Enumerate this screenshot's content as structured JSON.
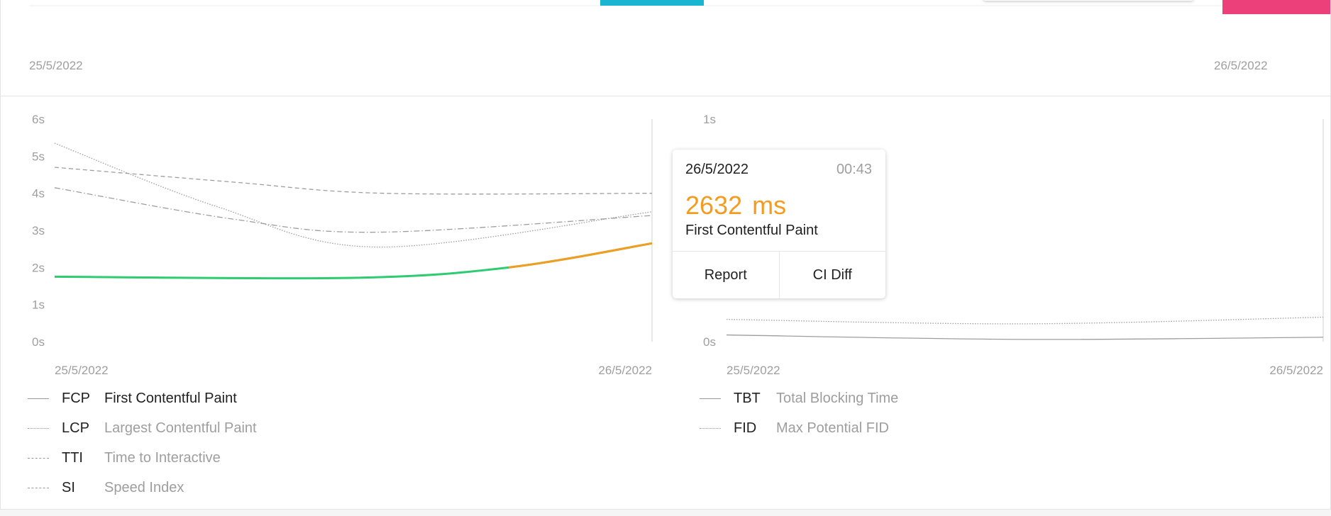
{
  "top_panel": {
    "x_start": "25/5/2022",
    "x_end": "26/5/2022",
    "colors": {
      "teal": "#1ab5d0",
      "pink": "#ec407a"
    }
  },
  "chart_data": [
    {
      "type": "line",
      "x": [
        "25/5/2022",
        "26/5/2022"
      ],
      "ylim": [
        0,
        6
      ],
      "y_unit": "s",
      "y_ticks": [
        "0s",
        "1s",
        "2s",
        "3s",
        "4s",
        "5s",
        "6s"
      ],
      "series": [
        {
          "name": "First Contentful Paint",
          "abbr": "FCP",
          "style": "solid",
          "color": "#2ecc71",
          "highlight_color": "#f39c1f",
          "points": [
            [
              0,
              1.75
            ],
            [
              0.5,
              1.72
            ],
            [
              0.76,
              2.0
            ],
            [
              1.0,
              2.65
            ]
          ]
        },
        {
          "name": "Largest Contentful Paint",
          "abbr": "LCP",
          "style": "dotted",
          "color": "#9e9e9e",
          "points": [
            [
              0,
              5.35
            ],
            [
              0.27,
              3.65
            ],
            [
              0.54,
              2.55
            ],
            [
              1.0,
              3.5
            ]
          ]
        },
        {
          "name": "Time to Interactive",
          "abbr": "TTI",
          "style": "dashed",
          "color": "#9e9e9e",
          "points": [
            [
              0,
              4.7
            ],
            [
              0.3,
              4.3
            ],
            [
              0.55,
              4.0
            ],
            [
              1.0,
              4.0
            ]
          ]
        },
        {
          "name": "Speed Index",
          "abbr": "SI",
          "style": "dashdot",
          "color": "#9e9e9e",
          "points": [
            [
              0,
              4.15
            ],
            [
              0.3,
              3.3
            ],
            [
              0.54,
              2.95
            ],
            [
              1.0,
              3.4
            ]
          ]
        }
      ]
    },
    {
      "type": "line",
      "x": [
        "25/5/2022",
        "26/5/2022"
      ],
      "y_ticks": [
        "0s",
        "1s"
      ],
      "ylim": [
        0,
        1
      ],
      "y_unit": "s",
      "series": [
        {
          "name": "Total Blocking Time",
          "abbr": "TBT",
          "style": "solid",
          "color": "#9e9e9e",
          "points": [
            [
              0,
              0.03
            ],
            [
              0.5,
              0.01
            ],
            [
              1.0,
              0.02
            ]
          ]
        },
        {
          "name": "Max Potential FID",
          "abbr": "FID",
          "style": "dotted",
          "color": "#9e9e9e",
          "points": [
            [
              0,
              0.1
            ],
            [
              0.5,
              0.08
            ],
            [
              1.0,
              0.11
            ]
          ]
        }
      ]
    }
  ],
  "tooltip": {
    "date": "26/5/2022",
    "time": "00:43",
    "value": "2632",
    "unit": "ms",
    "metric": "First Contentful Paint",
    "report_label": "Report",
    "ci_diff_label": "CI Diff",
    "value_color": "#f39c1f"
  }
}
